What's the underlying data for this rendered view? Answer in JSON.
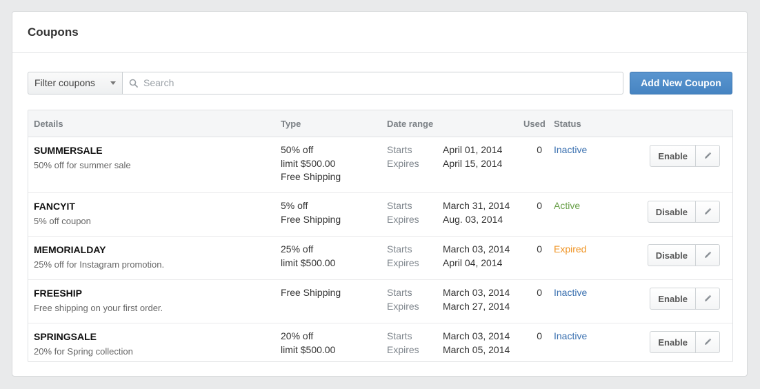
{
  "panel": {
    "title": "Coupons"
  },
  "toolbar": {
    "filter_label": "Filter coupons",
    "search_placeholder": "Search",
    "add_label": "Add New Coupon"
  },
  "columns": {
    "details": "Details",
    "type": "Type",
    "date_range": "Date range",
    "used": "Used",
    "status": "Status"
  },
  "labels": {
    "starts": "Starts",
    "expires": "Expires"
  },
  "colors": {
    "accent": "#4a88c7",
    "inactive": "#3a70b0",
    "active": "#6aa04a",
    "expired": "#ef9322"
  },
  "coupons": [
    {
      "name": "SUMMERSALE",
      "description": "50% off for summer sale",
      "type_lines": [
        "50% off",
        "limit $500.00",
        "Free Shipping"
      ],
      "starts": "April 01, 2014",
      "expires": "April 15, 2014",
      "used": "0",
      "status": "Inactive",
      "action": "Enable"
    },
    {
      "name": "FANCYIT",
      "description": "5% off coupon",
      "type_lines": [
        "5% off",
        "Free Shipping"
      ],
      "starts": "March 31, 2014",
      "expires": "Aug. 03, 2014",
      "used": "0",
      "status": "Active",
      "action": "Disable"
    },
    {
      "name": "MEMORIALDAY",
      "description": "25% off for Instagram promotion.",
      "type_lines": [
        "25% off",
        "limit $500.00"
      ],
      "starts": "March 03, 2014",
      "expires": "April 04, 2014",
      "used": "0",
      "status": "Expired",
      "action": "Disable"
    },
    {
      "name": "FREESHIP",
      "description": "Free shipping on your first order.",
      "type_lines": [
        "Free Shipping"
      ],
      "starts": "March 03, 2014",
      "expires": "March 27, 2014",
      "used": "0",
      "status": "Inactive",
      "action": "Enable"
    },
    {
      "name": "SPRINGSALE",
      "description": "20% for Spring collection",
      "type_lines": [
        "20% off",
        "limit $500.00"
      ],
      "starts": "March 03, 2014",
      "expires": "March 05, 2014",
      "used": "0",
      "status": "Inactive",
      "action": "Enable"
    }
  ]
}
